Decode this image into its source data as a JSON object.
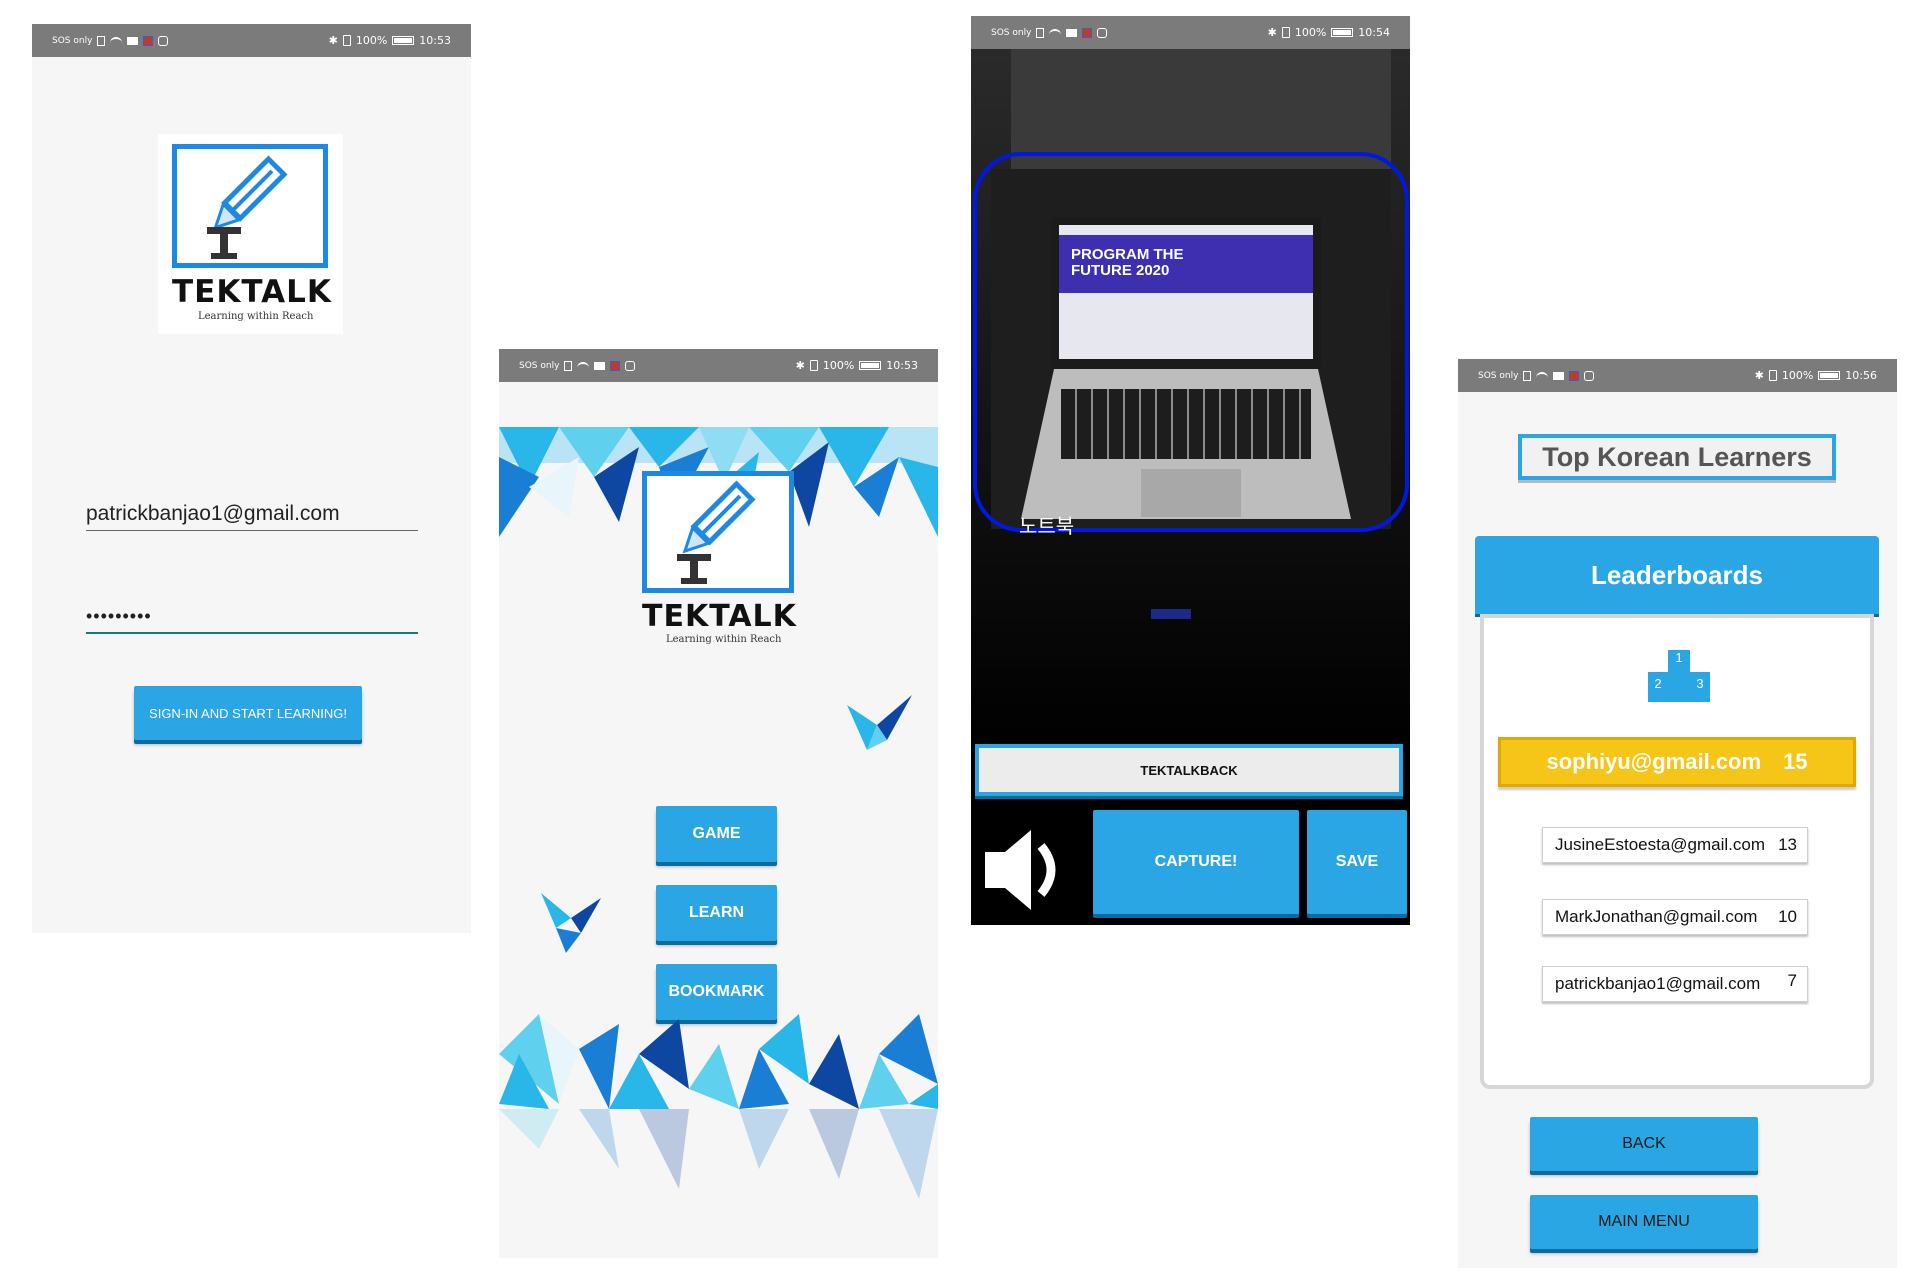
{
  "statusbar": {
    "sos_label": "SOS only",
    "battery_pct": "100%",
    "times": [
      "10:53",
      "10:53",
      "10:54",
      "10:56"
    ]
  },
  "logo": {
    "wordmark": "TEKTALK",
    "tagline": "Learning within Reach"
  },
  "signin": {
    "email_value": "patrickbanjao1@gmail.com",
    "password_value": "•••••••••",
    "submit_label": "SIGN-IN AND START LEARNING!"
  },
  "menu": {
    "buttons": [
      "GAME",
      "LEARN",
      "BOOKMARK"
    ]
  },
  "camera": {
    "detected_label": "노트북",
    "laptop_screen_text": "PROGRAM THE FUTURE 2020",
    "back_label": "TEKTALKBACK",
    "capture_label": "CAPTURE!",
    "save_label": "SAVE"
  },
  "leaderboard": {
    "title": "Top Korean Learners",
    "header": "Leaderboards",
    "podium": [
      "1",
      "2",
      "3"
    ],
    "top": {
      "email": "sophiyu@gmail.com",
      "score": "15"
    },
    "rows": [
      {
        "email": "JusineEstoesta@gmail.com",
        "score": "13"
      },
      {
        "email": "MarkJonathan@gmail.com",
        "score": "10"
      },
      {
        "email": "patrickbanjao1@gmail.com",
        "score": "7"
      }
    ],
    "back_label": "BACK",
    "main_menu_label": "MAIN MENU"
  },
  "colors": {
    "accent": "#29a6e3",
    "logo_blue": "#1e88e5",
    "highlight": "#f5c518",
    "bbox": "#0018e0"
  }
}
